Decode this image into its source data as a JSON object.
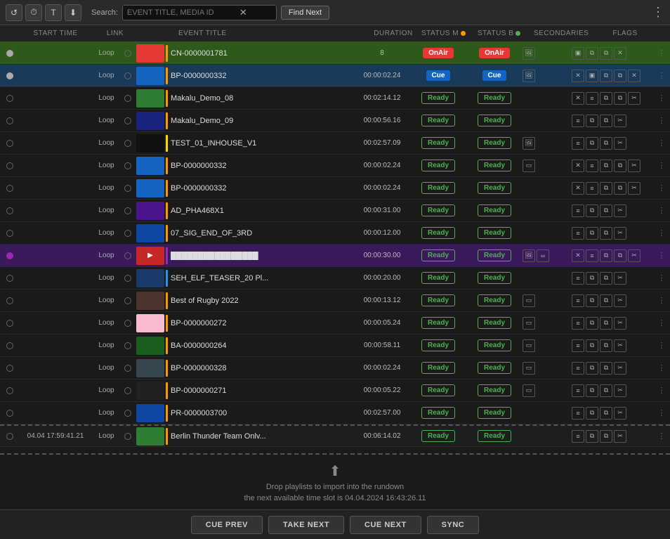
{
  "topbar": {
    "search_label": "Search:",
    "search_placeholder": "EVENT TITLE, MEDIA ID",
    "find_next_label": "Find Next"
  },
  "headers": {
    "start_time": "START TIME",
    "link": "LINK",
    "event_title": "EVENT TITLE",
    "duration": "DURATION",
    "status_m": "STATUS M",
    "status_b": "STATUS B",
    "secondaries": "SECONDARIES",
    "flags": "FLAGS"
  },
  "rows": [
    {
      "id": 0,
      "loop": "Loop",
      "starttime": "",
      "title": "CN-0000001781",
      "duration": "8",
      "statusM": "OnAir",
      "statusB": "OnAir",
      "bar": "orange",
      "type": "onair",
      "thumb": "#e53935",
      "hasImage": true
    },
    {
      "id": 1,
      "loop": "Loop",
      "starttime": "",
      "title": "BP-0000000332",
      "duration": "00:00:02.24",
      "statusM": "Cue",
      "statusB": "Cue",
      "bar": "orange",
      "type": "cue",
      "thumb": "#1565c0",
      "hasX": true,
      "hasImage": true
    },
    {
      "id": 2,
      "loop": "Loop",
      "starttime": "",
      "title": "Makalu_Demo_08",
      "duration": "00:02:14.12",
      "statusM": "Ready",
      "statusB": "Ready",
      "bar": "orange",
      "type": "normal",
      "thumb": "#2e7d32",
      "hasX": true
    },
    {
      "id": 3,
      "loop": "Loop",
      "starttime": "",
      "title": "Makalu_Demo_09",
      "duration": "00:00:56.16",
      "statusM": "Ready",
      "statusB": "Ready",
      "bar": "orange",
      "type": "normal",
      "thumb": "#1a237e"
    },
    {
      "id": 4,
      "loop": "Loop",
      "starttime": "",
      "title": "TEST_01_INHOUSE_V1",
      "duration": "00:02:57.09",
      "statusM": "Ready",
      "statusB": "Ready",
      "bar": "yellow",
      "type": "normal",
      "thumb": "#111",
      "hasImage": true
    },
    {
      "id": 5,
      "loop": "Loop",
      "starttime": "",
      "title": "BP-0000000332",
      "duration": "00:00:02.24",
      "statusM": "Ready",
      "statusB": "Ready",
      "bar": "orange",
      "type": "normal",
      "thumb": "#1565c0",
      "hasRect": true,
      "hasX": true
    },
    {
      "id": 6,
      "loop": "Loop",
      "starttime": "",
      "title": "BP-0000000332",
      "duration": "00:00:02.24",
      "statusM": "Ready",
      "statusB": "Ready",
      "bar": "orange",
      "type": "normal",
      "thumb": "#1565c0",
      "hasX": true
    },
    {
      "id": 7,
      "loop": "Loop",
      "starttime": "",
      "title": "AD_PHA468X1",
      "duration": "00:00:31.00",
      "statusM": "Ready",
      "statusB": "Ready",
      "bar": "orange",
      "type": "normal",
      "thumb": "#4a148c"
    },
    {
      "id": 8,
      "loop": "Loop",
      "starttime": "",
      "title": "07_SIG_END_OF_3RD",
      "duration": "00:00:12.00",
      "statusM": "Ready",
      "statusB": "Ready",
      "bar": "orange",
      "type": "normal",
      "thumb": "#0d47a1"
    },
    {
      "id": 9,
      "loop": "Loop",
      "starttime": "",
      "title": "████████████████",
      "duration": "00:00:30.00",
      "statusM": "Ready",
      "statusB": "Ready",
      "bar": "purple",
      "type": "purple",
      "thumb": "#c62828",
      "hasImage": true,
      "hasX": true,
      "hasInfinity": true,
      "isYT": true
    },
    {
      "id": 10,
      "loop": "Loop",
      "starttime": "",
      "title": "SEH_ELF_TEASER_20 Pl...",
      "duration": "00:00:20.00",
      "statusM": "Ready",
      "statusB": "Ready",
      "bar": "blue",
      "type": "normal",
      "thumb": "#1a3a6a"
    },
    {
      "id": 11,
      "loop": "Loop",
      "starttime": "",
      "title": "Best of Rugby 2022",
      "duration": "00:00:13.12",
      "statusM": "Ready",
      "statusB": "Ready",
      "bar": "orange",
      "type": "normal",
      "thumb": "#4e342e",
      "hasRect": true
    },
    {
      "id": 12,
      "loop": "Loop",
      "starttime": "",
      "title": "BP-0000000272",
      "duration": "00:00:05.24",
      "statusM": "Ready",
      "statusB": "Ready",
      "bar": "orange",
      "type": "normal",
      "thumb": "#f8bbd0",
      "hasRect": true
    },
    {
      "id": 13,
      "loop": "Loop",
      "starttime": "",
      "title": "BA-0000000264",
      "duration": "00:00:58.11",
      "statusM": "Ready",
      "statusB": "Ready",
      "bar": "orange",
      "type": "normal",
      "thumb": "#1b5e20",
      "hasRect": true
    },
    {
      "id": 14,
      "loop": "Loop",
      "starttime": "",
      "title": "BP-0000000328",
      "duration": "00:00:02.24",
      "statusM": "Ready",
      "statusB": "Ready",
      "bar": "orange",
      "type": "normal",
      "thumb": "#37474f",
      "hasRect": true
    },
    {
      "id": 15,
      "loop": "Loop",
      "starttime": "",
      "title": "BP-0000000271",
      "duration": "00:00:05.22",
      "statusM": "Ready",
      "statusB": "Ready",
      "bar": "orange",
      "type": "normal",
      "thumb": "#212121",
      "hasRect": true
    },
    {
      "id": 16,
      "loop": "Loop",
      "starttime": "",
      "title": "PR-0000003700",
      "duration": "00:02:57.00",
      "statusM": "Ready",
      "statusB": "Ready",
      "bar": "orange",
      "type": "normal",
      "thumb": "#0d47a1"
    },
    {
      "id": 17,
      "loop": "Loop",
      "starttime": "04.04  17:59:41.21",
      "title": "Berlin Thunder Team Onlv...",
      "duration": "00:06:14.02",
      "statusM": "Ready",
      "statusB": "Ready",
      "bar": "orange",
      "type": "bottom",
      "thumb": "#2e7d32"
    }
  ],
  "dropzone": {
    "text": "Drop playlists to import into the rundown",
    "time_label": "the next available time slot is 04.04.2024 16:43:26.11"
  },
  "actions": {
    "cue_prev": "CUE PREV",
    "take_next": "TAKE NEXT",
    "cue_next": "CUE NEXT",
    "sync": "SYNC"
  }
}
